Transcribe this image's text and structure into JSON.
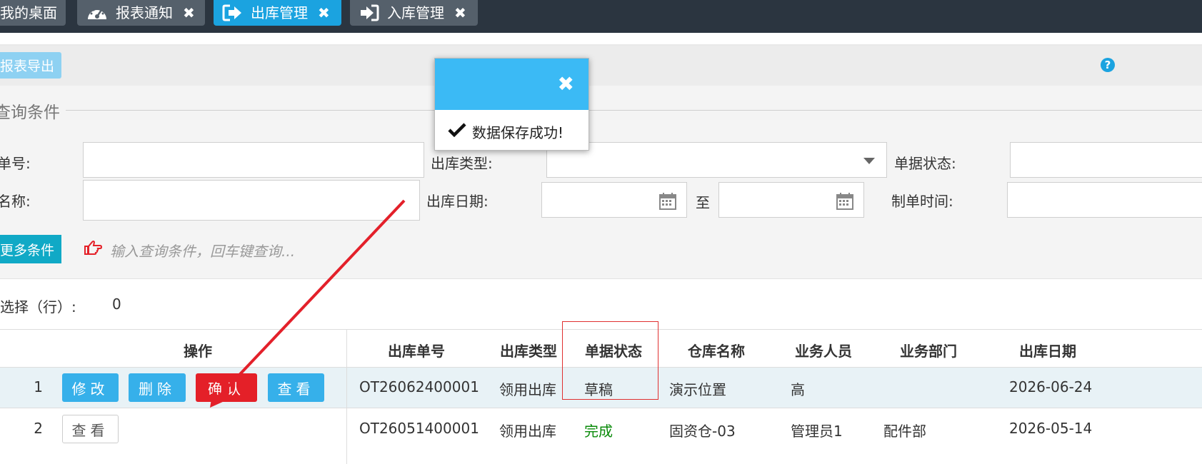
{
  "tabs": [
    {
      "label": "我的桌面",
      "icon": "home-icon",
      "closable": false,
      "active": false
    },
    {
      "label": "报表通知",
      "icon": "dashboard-icon",
      "closable": true,
      "active": false
    },
    {
      "label": "出库管理",
      "icon": "sign-out-icon",
      "closable": true,
      "active": true
    },
    {
      "label": "入库管理",
      "icon": "sign-in-icon",
      "closable": true,
      "active": false
    }
  ],
  "close_glyph": "✖",
  "toolbar": {
    "export_label": "报表导出",
    "help_glyph": "?"
  },
  "query": {
    "legend": "查询条件",
    "labels": {
      "order_no": "单号:",
      "out_type": "出库类型:",
      "doc_status": "单据状态:",
      "name": "名称:",
      "out_date": "出库日期:",
      "to": "至",
      "create_time": "制单时间:"
    },
    "more_label": "更多条件",
    "hint": "输入查询条件，回车键查询..."
  },
  "selection": {
    "label": "选择（行）:",
    "count": "0"
  },
  "table": {
    "headers": [
      "操作",
      "出库单号",
      "出库类型",
      "单据状态",
      "仓库名称",
      "业务人员",
      "业务部门",
      "出库日期"
    ],
    "rows": [
      {
        "num": "1",
        "actions": [
          "修改",
          "删除",
          "确认",
          "查看"
        ],
        "order_no": "OT26062400001",
        "type": "领用出库",
        "status": "草稿",
        "warehouse": "演示位置",
        "staff": "高",
        "dept": "",
        "date": "2026-06-24"
      },
      {
        "num": "2",
        "actions": [
          "查看"
        ],
        "order_no": "OT26051400001",
        "type": "领用出库",
        "status": "完成",
        "warehouse": "固资仓-03",
        "staff": "管理员1",
        "dept": "配件部",
        "date": "2026-05-14"
      }
    ]
  },
  "toast": {
    "close_glyph": "✖",
    "message": "数据保存成功!"
  },
  "colors": {
    "accent": "#1ba3e0",
    "danger": "#e42028",
    "annotation": "#e3202a"
  }
}
